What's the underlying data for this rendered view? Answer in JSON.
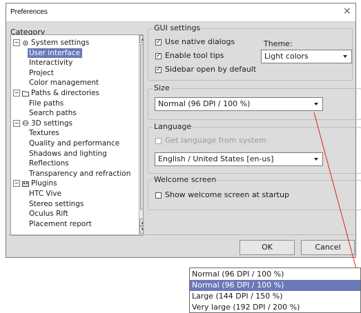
{
  "window": {
    "title": "Preferences",
    "close_glyph": "×"
  },
  "category": {
    "label": "Category",
    "items": [
      {
        "label": "System settings",
        "expander": "⊟",
        "icon": "gear-icon"
      },
      {
        "label": "User interface",
        "selected": true
      },
      {
        "label": "Interactivity"
      },
      {
        "label": "Project"
      },
      {
        "label": "Color management"
      },
      {
        "label": "Paths & directories",
        "expander": "⊟",
        "icon": "folder-icon"
      },
      {
        "label": "File paths"
      },
      {
        "label": "Search paths"
      },
      {
        "label": "3D settings",
        "expander": "⊟",
        "icon": "cube-icon"
      },
      {
        "label": "Textures"
      },
      {
        "label": "Quality and performance"
      },
      {
        "label": "Shadows and lighting"
      },
      {
        "label": "Reflections"
      },
      {
        "label": "Transparency and refraction"
      },
      {
        "label": "Plugins",
        "expander": "⊟",
        "icon": "plugin-icon"
      },
      {
        "label": "HTC Vive"
      },
      {
        "label": "Stereo settings"
      },
      {
        "label": "Oculus Rift"
      },
      {
        "label": "Placement report"
      }
    ]
  },
  "gui": {
    "legend": "GUI settings",
    "use_native_dialogs": {
      "label": "Use native dialogs",
      "checked": true
    },
    "enable_tool_tips": {
      "label": "Enable tool tips",
      "checked": true
    },
    "sidebar_open": {
      "label": "Sidebar open by default",
      "checked": true
    },
    "theme_label": "Theme:",
    "theme_value": "Light colors"
  },
  "size": {
    "legend": "Size",
    "value": "Normal (96 DPI / 100 %)"
  },
  "language": {
    "legend": "Language",
    "get_from_system": {
      "label": "Get language from system",
      "checked": false,
      "disabled": true
    },
    "value": "English / United States  [en-us]"
  },
  "welcome": {
    "legend": "Welcome screen",
    "show_at_startup": {
      "label": "Show welcome screen at startup",
      "checked": false
    }
  },
  "buttons": {
    "ok": "OK",
    "cancel": "Cancel"
  },
  "size_dropdown": {
    "current": "Normal (96 DPI / 100 %)",
    "options": [
      {
        "label": "Normal (96 DPI / 100 %)",
        "highlighted": true
      },
      {
        "label": "Large (144 DPI / 150 %)"
      },
      {
        "label": "Very large (192 DPI / 200 %)"
      }
    ]
  },
  "colors": {
    "selection": "#6b79b8",
    "annotation_line": "#e02020",
    "dialog_bg": "#dcdcdc"
  }
}
